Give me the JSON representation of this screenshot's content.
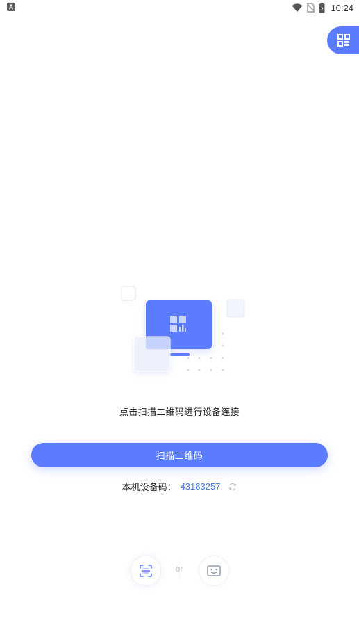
{
  "status_bar": {
    "app_icon_letter": "A",
    "time": "10:24",
    "icons": [
      "wifi-icon",
      "no-sim-icon",
      "battery-icon"
    ]
  },
  "floating_tab": {
    "icon": "qr-code-icon"
  },
  "illustration": {
    "icon": "monitor-qr-illustration",
    "accent_color": "#5b7cff"
  },
  "main": {
    "hint": "点击扫描二维码进行设备连接",
    "scan_button_label": "扫描二维码",
    "device_code_label": "本机设备码：",
    "device_code_value": "43183257",
    "refresh_icon": "refresh-icon"
  },
  "bottom_options": {
    "or_text": "or",
    "left_icon": "scan-frame-icon",
    "right_icon": "device-code-icon"
  },
  "colors": {
    "primary": "#5b7cff",
    "code_value": "#4a78d6",
    "text": "#222222"
  }
}
